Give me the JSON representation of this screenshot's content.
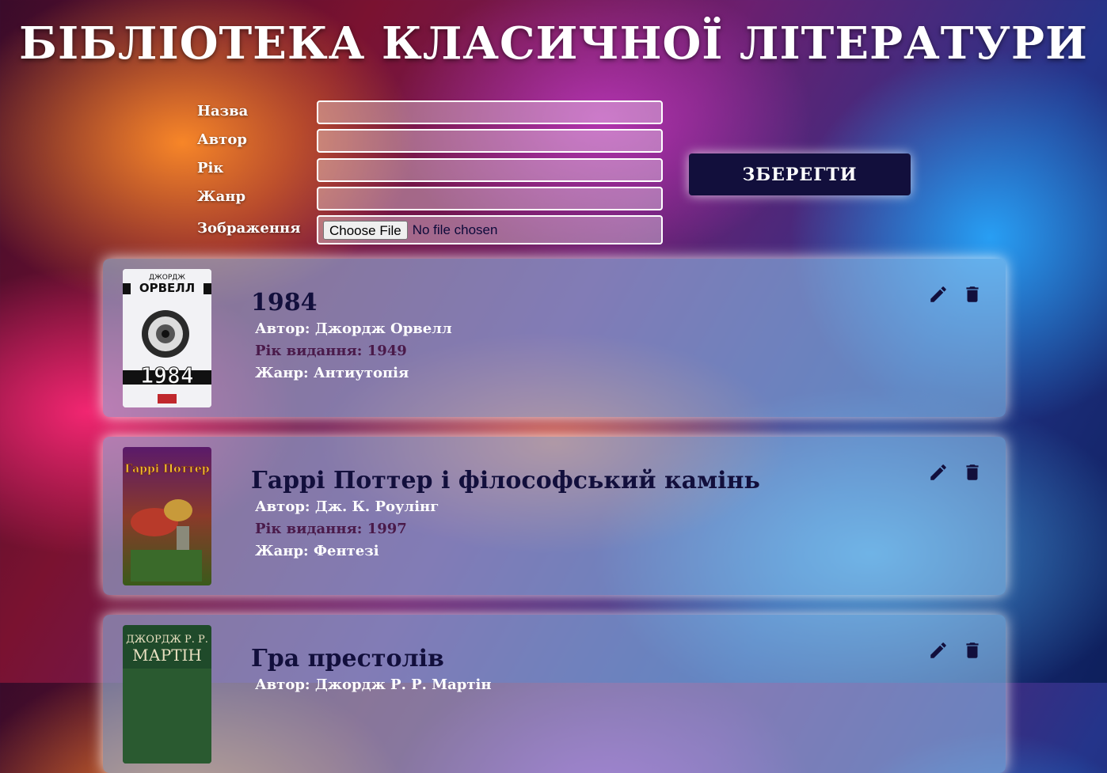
{
  "page": {
    "title": "БІБЛІОТЕКА КЛАСИЧНОЇ ЛІТЕРАТУРИ"
  },
  "form": {
    "labels": {
      "name": "Назва",
      "author": "Автор",
      "year": "Рік",
      "genre": "Жанр",
      "image": "Зображення"
    },
    "values": {
      "name": "",
      "author": "",
      "year": "",
      "genre": ""
    },
    "file_button": "Choose File",
    "file_status": "No file chosen",
    "save_label": "ЗБЕРЕГТИ"
  },
  "books": [
    {
      "title": "1984",
      "author": "Автор: Джордж Орвелл",
      "year": "Рік видання: 1949",
      "genre": "Жанр: Антиутопія",
      "cover": {
        "top_text": "ДЖОРДЖ",
        "name_text": "ОРВЕЛЛ",
        "big_text": "1984"
      }
    },
    {
      "title": "Гаррі Поттер і філософський камінь",
      "author": "Автор: Дж. К. Роулінг",
      "year": "Рік видання: 1997",
      "genre": "Жанр: Фентезі",
      "cover": {
        "big_text": "Гаррі Поттер"
      }
    },
    {
      "title": "Гра престолів",
      "author": "Автор: Джордж Р. Р. Мартін",
      "year": "",
      "genre": "",
      "cover": {
        "top_text": "ДЖОРДЖ Р. Р.",
        "name_text": "МАРТІН"
      }
    }
  ],
  "icons": {
    "edit": "pencil-icon",
    "delete": "trash-icon"
  },
  "colors": {
    "accent": "#120f3c",
    "card_bg": "#96c8f0"
  }
}
